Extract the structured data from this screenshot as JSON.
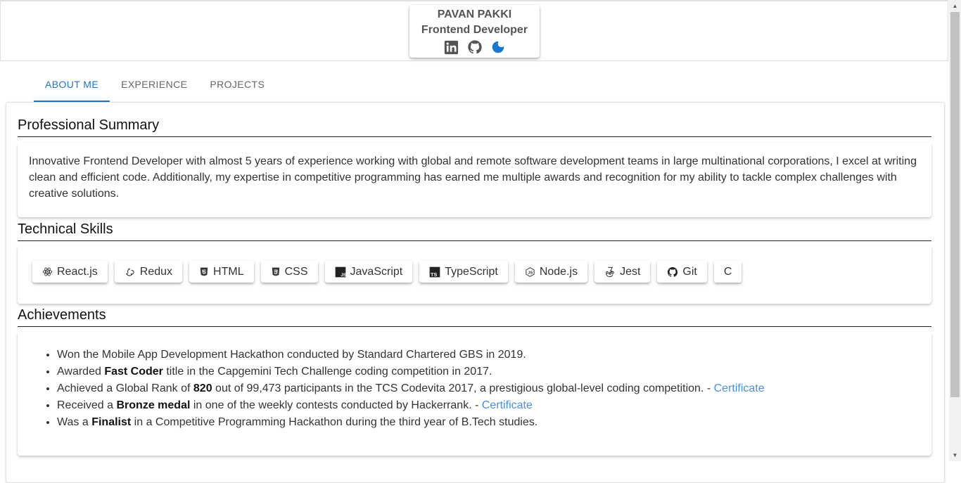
{
  "profile": {
    "name": "PAVAN PAKKI",
    "title": "Frontend Developer",
    "icons": [
      "linkedin-icon",
      "github-icon",
      "dark-mode-icon"
    ]
  },
  "tabs": [
    {
      "label": "ABOUT ME",
      "active": true
    },
    {
      "label": "EXPERIENCE",
      "active": false
    },
    {
      "label": "PROJECTS",
      "active": false
    }
  ],
  "summary": {
    "heading": "Professional Summary",
    "text": "Innovative Frontend Developer with almost 5 years of experience working with global and remote software development teams in large multinational corporations, I excel at writing clean and efficient code. Additionally, my expertise in competitive programming has earned me multiple awards and recognition for my ability to tackle complex challenges with creative solutions."
  },
  "skills": {
    "heading": "Technical Skills",
    "items": [
      {
        "label": "React.js",
        "icon": "react-icon"
      },
      {
        "label": "Redux",
        "icon": "redux-icon"
      },
      {
        "label": "HTML",
        "icon": "html5-icon"
      },
      {
        "label": "CSS",
        "icon": "css3-icon"
      },
      {
        "label": "JavaScript",
        "icon": "javascript-icon"
      },
      {
        "label": "TypeScript",
        "icon": "typescript-icon"
      },
      {
        "label": "Node.js",
        "icon": "nodejs-icon"
      },
      {
        "label": "Jest",
        "icon": "jest-icon"
      },
      {
        "label": "Git",
        "icon": "github-icon"
      },
      {
        "label": "C",
        "icon": ""
      }
    ]
  },
  "achievements": {
    "heading": "Achievements",
    "items": [
      {
        "pre": "Won the Mobile App Development Hackathon conducted by Standard Chartered GBS in 2019.",
        "bold": "",
        "post": "",
        "link": ""
      },
      {
        "pre": "Awarded ",
        "bold": "Fast Coder",
        "post": " title in the Capgemini Tech Challenge coding competition in 2017.",
        "link": ""
      },
      {
        "pre": "Achieved a Global Rank of ",
        "bold": "820",
        "post": " out of 99,473 participants in the TCS Codevita 2017, a prestigious global-level coding competition. - ",
        "link": "Certificate"
      },
      {
        "pre": "Received a ",
        "bold": "Bronze medal",
        "post": " in one of the weekly contests conducted by Hackerrank. - ",
        "link": "Certificate"
      },
      {
        "pre": "Was a ",
        "bold": "Finalist",
        "post": " in a Competitive Programming Hackathon during the third year of B.Tech studies.",
        "link": ""
      }
    ]
  },
  "colors": {
    "accent": "#1976d2",
    "link": "#4a8fdc"
  }
}
